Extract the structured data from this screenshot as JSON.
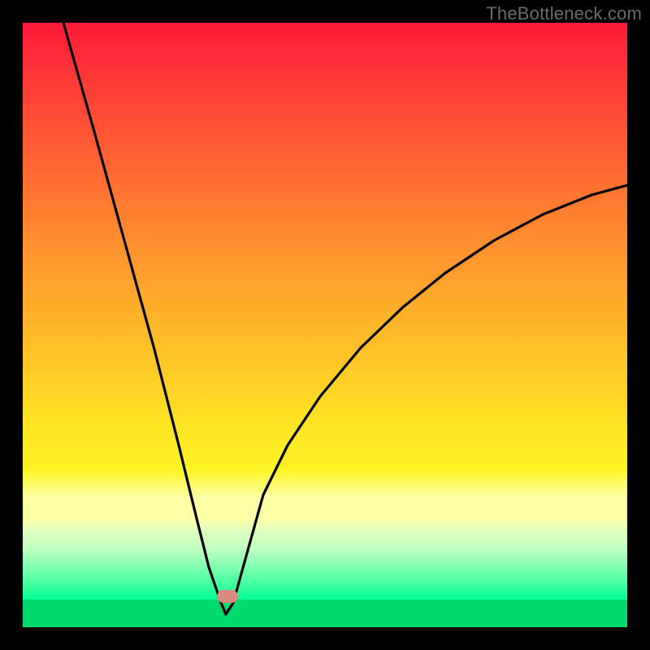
{
  "watermark": "TheBottleneck.com",
  "chart_data": {
    "type": "line",
    "title": "",
    "xlabel": "",
    "ylabel": "",
    "xlim": [
      0,
      100
    ],
    "ylim": [
      0,
      100
    ],
    "grid": false,
    "legend": false,
    "series": [
      {
        "name": "curve",
        "x": [
          7,
          12,
          17,
          22,
          26,
          29,
          31,
          33,
          34,
          35,
          37,
          40,
          44,
          50,
          56,
          63,
          70,
          78,
          86,
          94,
          100
        ],
        "y": [
          100,
          82,
          64,
          46,
          30,
          18,
          10,
          4,
          1,
          0,
          2,
          8,
          18,
          30,
          40,
          48,
          55,
          62,
          68,
          73,
          76
        ]
      }
    ],
    "marker": {
      "x": 34,
      "y": 0,
      "color": "#d98a7e"
    },
    "background_gradient": [
      "#ff1a3a",
      "#ff6a32",
      "#ffbb29",
      "#fff423",
      "#fcffa6",
      "#00f57f"
    ]
  }
}
